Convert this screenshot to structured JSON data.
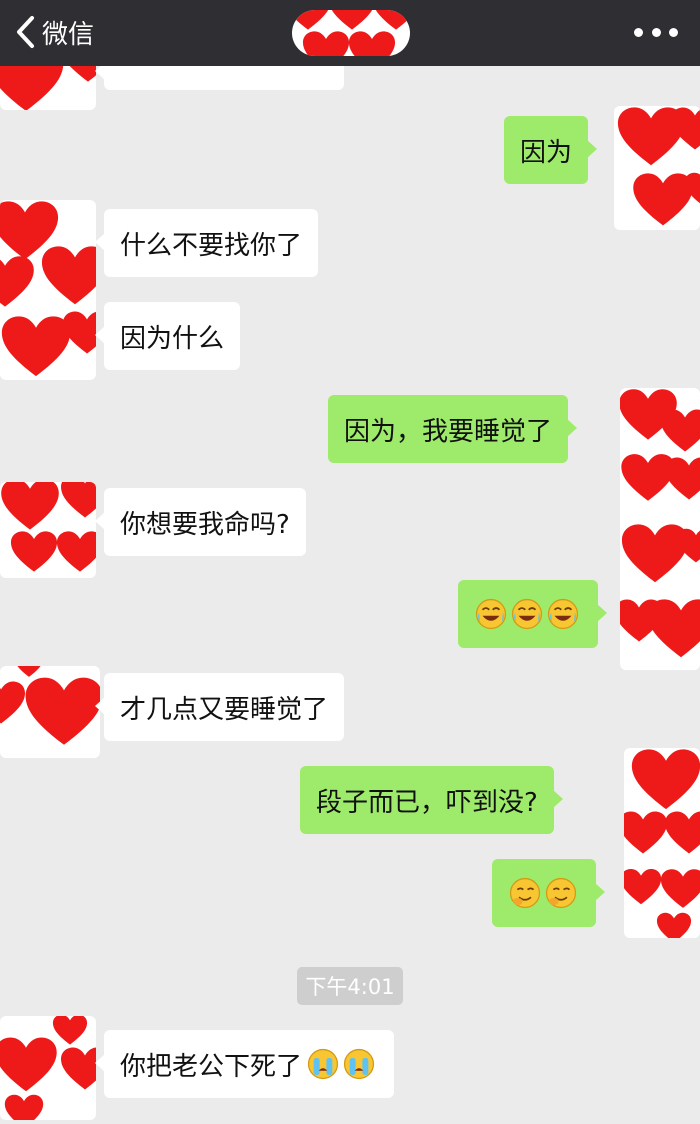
{
  "header": {
    "back_label": "微信",
    "back_icon": "chevron-left-icon",
    "menu_icon": "more-dots-icon"
  },
  "colors": {
    "header_bg": "#2f2f33",
    "chat_bg": "#ebebeb",
    "outgoing_bubble": "#9eea6a",
    "incoming_bubble": "#ffffff",
    "timestamp_bg": "#cecece"
  },
  "messages": [
    {
      "side": "out",
      "text": "因为"
    },
    {
      "side": "in",
      "text": "什么不要找你了"
    },
    {
      "side": "in",
      "text": "因为什么"
    },
    {
      "side": "out",
      "text": "因为，我要睡觉了"
    },
    {
      "side": "in",
      "text": "你想要我命吗?"
    },
    {
      "side": "out",
      "emoji": [
        "laughing-crying-emoji",
        "laughing-crying-emoji",
        "laughing-crying-emoji"
      ]
    },
    {
      "side": "in",
      "text": "才几点又要睡觉了"
    },
    {
      "side": "out",
      "text": "段子而已，吓到没?"
    },
    {
      "side": "out",
      "emoji": [
        "chuckle-emoji",
        "chuckle-emoji"
      ]
    },
    {
      "side": "in",
      "text": "你把老公下死了",
      "emoji": [
        "crying-emoji",
        "crying-emoji"
      ]
    }
  ],
  "timestamp": "下午4:01"
}
